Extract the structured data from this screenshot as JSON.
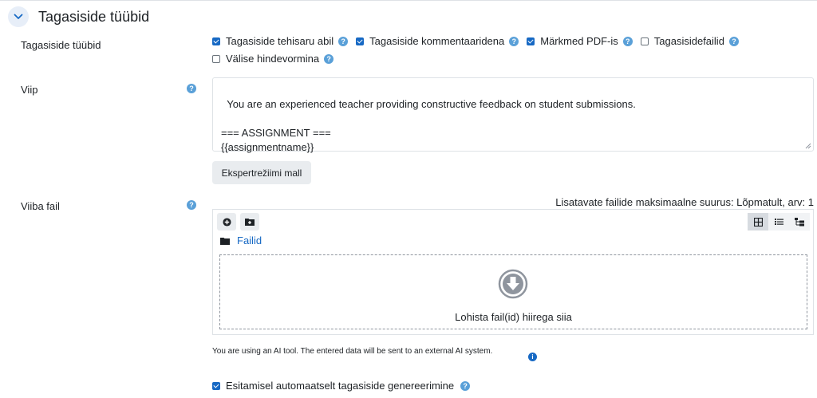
{
  "section": {
    "title": "Tagasiside tüübid",
    "toggle_icon": "chevron-down-icon"
  },
  "feedback_types": {
    "label": "Tagasiside tüübid",
    "options": [
      {
        "label": "Tagasiside tehisaru abil",
        "checked": true
      },
      {
        "label": "Tagasiside kommentaaridena",
        "checked": true
      },
      {
        "label": "Märkmed PDF-is",
        "checked": true
      },
      {
        "label": "Tagasisidefailid",
        "checked": false
      },
      {
        "label": "Välise hindevormina",
        "checked": false
      }
    ]
  },
  "prompt": {
    "label": "Viip",
    "value": "You are an experienced teacher providing constructive feedback on student submissions.\n\n=== ASSIGNMENT ===\n{{assignmentname}}",
    "expert_button": "Ekspertrežiimi mall"
  },
  "prompt_file": {
    "label": "Viiba fail",
    "max_size": "Lisatavate failide maksimaalne suurus: Lõpmatult, arv: 1",
    "folder_label": "Failid",
    "dropzone_text": "Lohista fail(id) hiirega siia"
  },
  "ai_notice": "You are using an AI tool. The entered data will be sent to an external AI system.",
  "auto_generate": {
    "label": "Esitamisel automaatselt tagasiside genereerimine",
    "checked": true
  },
  "colors": {
    "accent": "#1769c4",
    "help": "#5aa0d8",
    "border": "#dee2e6"
  }
}
